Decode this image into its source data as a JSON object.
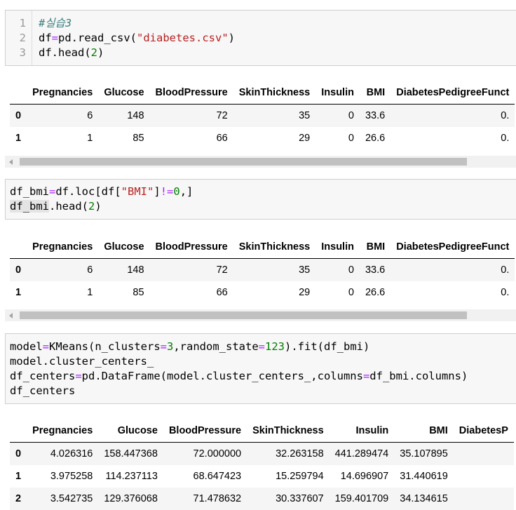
{
  "cells": [
    {
      "code_lines": [
        [
          {
            "t": "#실습3",
            "c": "cm-comment"
          }
        ],
        [
          {
            "t": "df"
          },
          {
            "t": "=",
            "c": "cm-op"
          },
          {
            "t": "pd.read_csv("
          },
          {
            "t": "\"diabetes.csv\"",
            "c": "cm-str"
          },
          {
            "t": ")"
          }
        ],
        [
          {
            "t": "df.head("
          },
          {
            "t": "2",
            "c": "cm-num"
          },
          {
            "t": ")"
          }
        ]
      ],
      "line_numbers": [
        "1",
        "2",
        "3"
      ]
    },
    {
      "code_lines": [
        [
          {
            "t": "df_bmi"
          },
          {
            "t": "=",
            "c": "cm-op"
          },
          {
            "t": "df.loc[df["
          },
          {
            "t": "\"BMI\"",
            "c": "cm-str"
          },
          {
            "t": "]"
          },
          {
            "t": "!=",
            "c": "cm-op"
          },
          {
            "t": "0",
            "c": "cm-num"
          },
          {
            "t": ",]"
          }
        ],
        [
          {
            "t": "df_bmi",
            "c": "cm-sel"
          },
          {
            "t": ".head("
          },
          {
            "t": "2",
            "c": "cm-num"
          },
          {
            "t": ")"
          }
        ]
      ]
    },
    {
      "code_lines": [
        [
          {
            "t": "model"
          },
          {
            "t": "=",
            "c": "cm-op"
          },
          {
            "t": "KMeans(n_clusters"
          },
          {
            "t": "=",
            "c": "cm-op"
          },
          {
            "t": "3",
            "c": "cm-num"
          },
          {
            "t": ",random_state"
          },
          {
            "t": "=",
            "c": "cm-op"
          },
          {
            "t": "123",
            "c": "cm-num"
          },
          {
            "t": ").fit(df_bmi)"
          }
        ],
        [
          {
            "t": "model.cluster_centers_"
          }
        ],
        [
          {
            "t": "df_centers"
          },
          {
            "t": "=",
            "c": "cm-op"
          },
          {
            "t": "pd.DataFrame(model.cluster_centers_,columns"
          },
          {
            "t": "=",
            "c": "cm-op"
          },
          {
            "t": "df_bmi.columns)"
          }
        ],
        [
          {
            "t": "df_centers"
          }
        ]
      ]
    }
  ],
  "table1": {
    "columns": [
      "",
      "Pregnancies",
      "Glucose",
      "BloodPressure",
      "SkinThickness",
      "Insulin",
      "BMI",
      "DiabetesPedigreeFunct"
    ],
    "rows": [
      [
        "0",
        "6",
        "148",
        "72",
        "35",
        "0",
        "33.6",
        "0."
      ],
      [
        "1",
        "1",
        "85",
        "66",
        "29",
        "0",
        "26.6",
        "0."
      ]
    ]
  },
  "table2": {
    "columns": [
      "",
      "Pregnancies",
      "Glucose",
      "BloodPressure",
      "SkinThickness",
      "Insulin",
      "BMI",
      "DiabetesPedigreeFunct"
    ],
    "rows": [
      [
        "0",
        "6",
        "148",
        "72",
        "35",
        "0",
        "33.6",
        "0."
      ],
      [
        "1",
        "1",
        "85",
        "66",
        "29",
        "0",
        "26.6",
        "0."
      ]
    ]
  },
  "table3": {
    "columns": [
      "",
      "Pregnancies",
      "Glucose",
      "BloodPressure",
      "SkinThickness",
      "Insulin",
      "BMI",
      "DiabetesP"
    ],
    "rows": [
      [
        "0",
        "4.026316",
        "158.447368",
        "72.000000",
        "32.263158",
        "441.289474",
        "35.107895",
        ""
      ],
      [
        "1",
        "3.975258",
        "114.237113",
        "68.647423",
        "15.259794",
        "14.696907",
        "31.440619",
        ""
      ],
      [
        "2",
        "3.542735",
        "129.376068",
        "71.478632",
        "30.337607",
        "159.401709",
        "34.134615",
        ""
      ]
    ]
  }
}
